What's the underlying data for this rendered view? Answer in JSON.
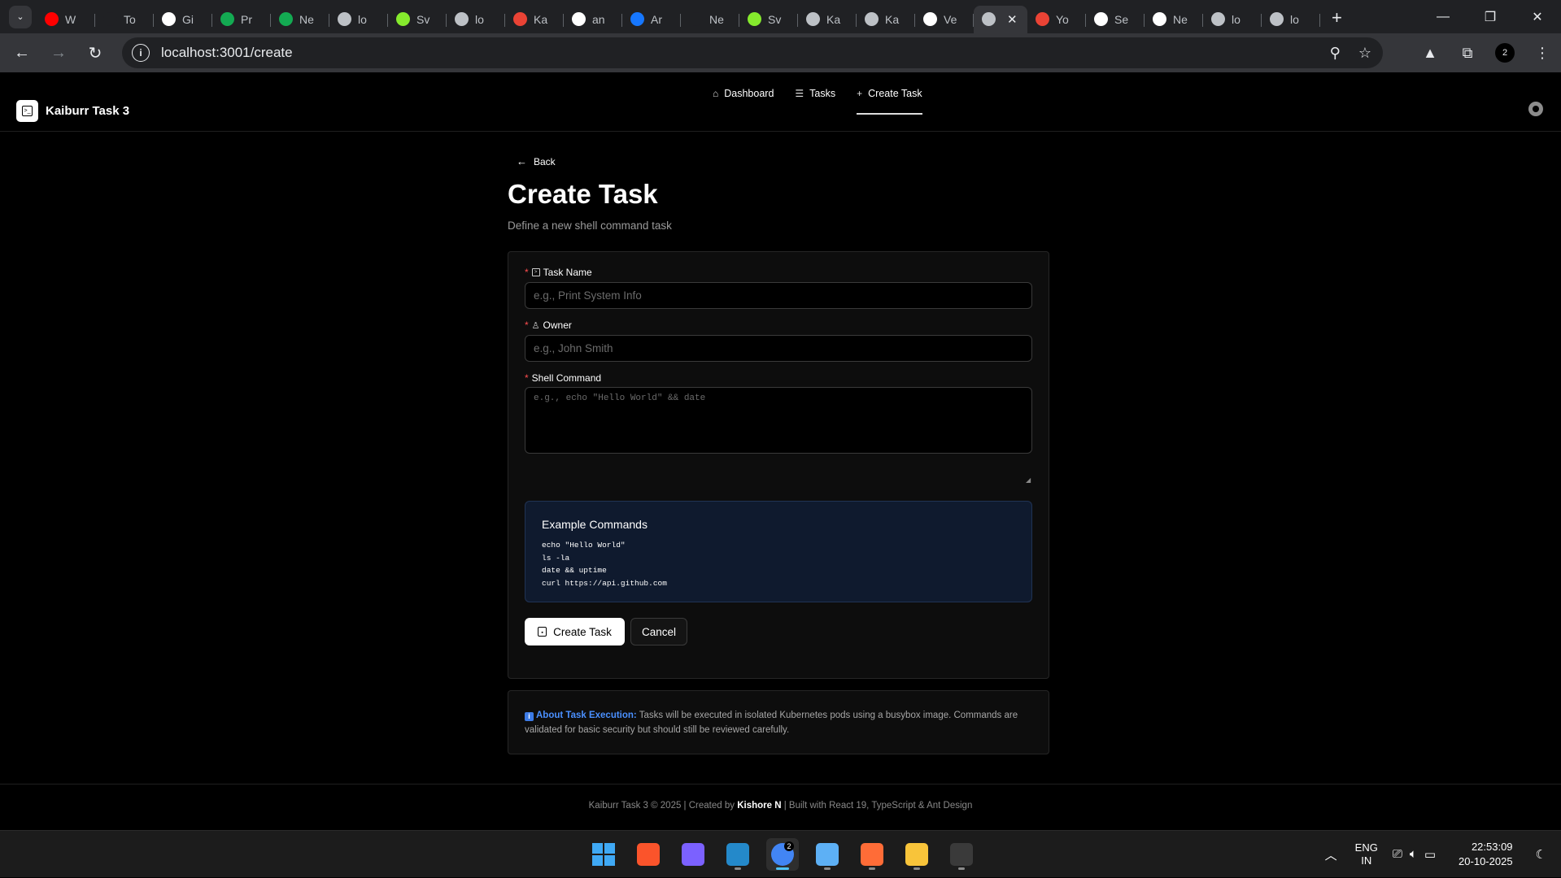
{
  "browser": {
    "tabs": [
      {
        "title": "W",
        "icon": "youtube-icon",
        "color": "#ff0000"
      },
      {
        "title": "To",
        "icon": "feather-icon",
        "color": "#202124"
      },
      {
        "title": "Gi",
        "icon": "github-icon",
        "color": "#ffffff"
      },
      {
        "title": "Pr",
        "icon": "mongodb-icon",
        "color": "#13aa52"
      },
      {
        "title": "Ne",
        "icon": "mongodb-icon",
        "color": "#13aa52"
      },
      {
        "title": "lo",
        "icon": "globe-icon",
        "color": "#bdc1c6"
      },
      {
        "title": "Sv",
        "icon": "swagger-icon",
        "color": "#85ea2d"
      },
      {
        "title": "lo",
        "icon": "globe-icon",
        "color": "#bdc1c6"
      },
      {
        "title": "Ka",
        "icon": "gmail-icon",
        "color": "#ea4335"
      },
      {
        "title": "an",
        "icon": "google-icon",
        "color": "#ffffff"
      },
      {
        "title": "Ar",
        "icon": "antd-icon",
        "color": "#1677ff"
      },
      {
        "title": "Ne",
        "icon": "blank-icon",
        "color": "#202124"
      },
      {
        "title": "Sv",
        "icon": "swagger-icon",
        "color": "#85ea2d"
      },
      {
        "title": "Ka",
        "icon": "globe-icon",
        "color": "#bdc1c6"
      },
      {
        "title": "Ka",
        "icon": "globe-icon",
        "color": "#bdc1c6"
      },
      {
        "title": "Ve",
        "icon": "vercel-icon",
        "color": "#ffffff"
      },
      {
        "title": "",
        "icon": "globe-icon",
        "color": "#bdc1c6",
        "active": true
      },
      {
        "title": "Yo",
        "icon": "gmail-icon",
        "color": "#ea4335"
      },
      {
        "title": "Se",
        "icon": "github-icon",
        "color": "#ffffff"
      },
      {
        "title": "Ne",
        "icon": "google-icon",
        "color": "#ffffff"
      },
      {
        "title": "lo",
        "icon": "globe-icon",
        "color": "#bdc1c6"
      },
      {
        "title": "lo",
        "icon": "globe-icon",
        "color": "#bdc1c6"
      }
    ],
    "url": "localhost:3001/create",
    "profile_initial": "2"
  },
  "app": {
    "brand": "Kaiburr Task 3",
    "nav": [
      {
        "label": "Dashboard",
        "icon": "home-icon"
      },
      {
        "label": "Tasks",
        "icon": "list-icon"
      },
      {
        "label": "Create Task",
        "icon": "plus-icon",
        "active": true
      }
    ]
  },
  "page": {
    "back_label": "Back",
    "title": "Create Task",
    "subtitle": "Define a new shell command task",
    "form": {
      "task_name": {
        "label": "Task Name",
        "placeholder": "e.g., Print System Info",
        "value": ""
      },
      "owner": {
        "label": "Owner",
        "placeholder": "e.g., John Smith",
        "value": ""
      },
      "command": {
        "label": "Shell Command",
        "placeholder": "e.g., echo \"Hello World\" && date",
        "value": ""
      }
    },
    "examples": {
      "title": "Example Commands",
      "commands": [
        "echo \"Hello World\"",
        "ls -la",
        "date && uptime",
        "curl https://api.github.com"
      ]
    },
    "buttons": {
      "submit": "Create Task",
      "cancel": "Cancel"
    },
    "info": {
      "heading": "About Task Execution:",
      "text": "Tasks will be executed in isolated Kubernetes pods using a busybox image. Commands are validated for basic security but should still be reviewed carefully."
    }
  },
  "footer": {
    "prefix": "Kaiburr Task 3 © 2025 | Created by",
    "author": "Kishore N",
    "suffix": "| Built with React 19, TypeScript & Ant Design"
  },
  "taskbar": {
    "apps": [
      {
        "name": "windows-start",
        "color": "#3fa9f5"
      },
      {
        "name": "brave",
        "color": "#fb542b"
      },
      {
        "name": "copilot",
        "color": "#7b61ff"
      },
      {
        "name": "vscode",
        "color": "#2489ca"
      },
      {
        "name": "chrome",
        "color": "#4285f4",
        "active": true,
        "badge": "2"
      },
      {
        "name": "notepad",
        "color": "#5db0f5"
      },
      {
        "name": "postman",
        "color": "#ff6c37"
      },
      {
        "name": "file-explorer",
        "color": "#f8c43a"
      },
      {
        "name": "terminal",
        "color": "#3a3a3a"
      }
    ],
    "lang_line1": "ENG",
    "lang_line2": "IN",
    "time": "22:53:09",
    "date": "20-10-2025"
  }
}
